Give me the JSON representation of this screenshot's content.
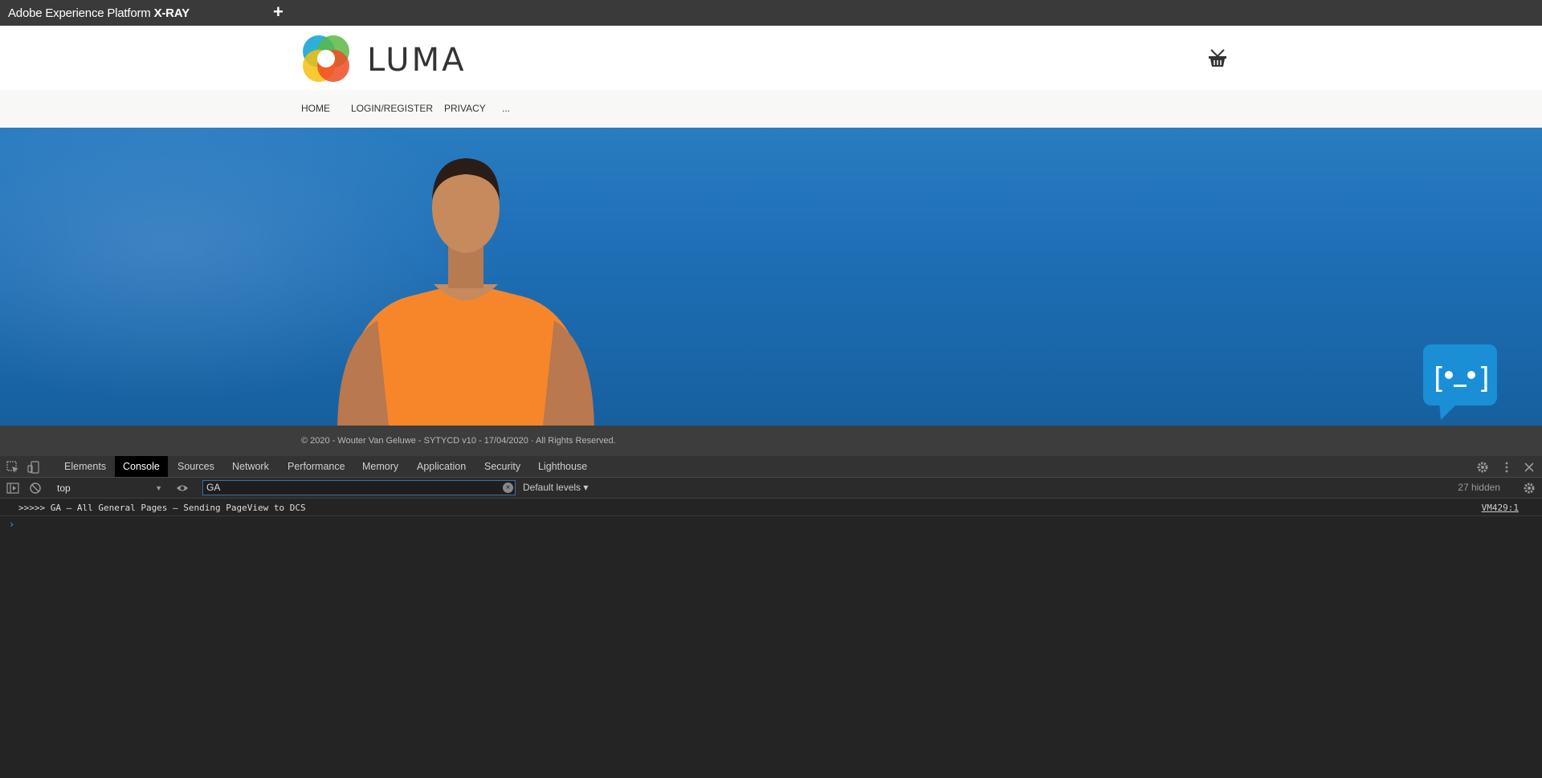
{
  "appbar": {
    "title_prefix": "Adobe Experience Platform ",
    "title_bold": "X-RAY",
    "new_tab_symbol": "+"
  },
  "site": {
    "logo_text": "LUMA",
    "nav": [
      "HOME",
      "LOGIN/REGISTER",
      "PRIVACY",
      "..."
    ],
    "footer": "© 2020 - Wouter Van Geluwe - SYTYCD v10 - 17/04/2020 · All Rights Reserved."
  },
  "devtools": {
    "tabs": [
      "Elements",
      "Console",
      "Sources",
      "Network",
      "Performance",
      "Memory",
      "Application",
      "Security",
      "Lighthouse"
    ],
    "active_tab": "Console",
    "context": "top",
    "filter_value": "GA",
    "levels": "Default levels",
    "hidden_count": "27 hidden",
    "console": [
      {
        "message": ">>>>> GA – All General Pages – Sending PageView to DCS",
        "source": "VM429:1"
      }
    ],
    "prompt": "›"
  },
  "colors": {
    "appbar": "#3a3a3a",
    "hero_sky": "#1e6fb6",
    "chatbot": "#1a8fd6",
    "devtools_bg": "#242424"
  }
}
